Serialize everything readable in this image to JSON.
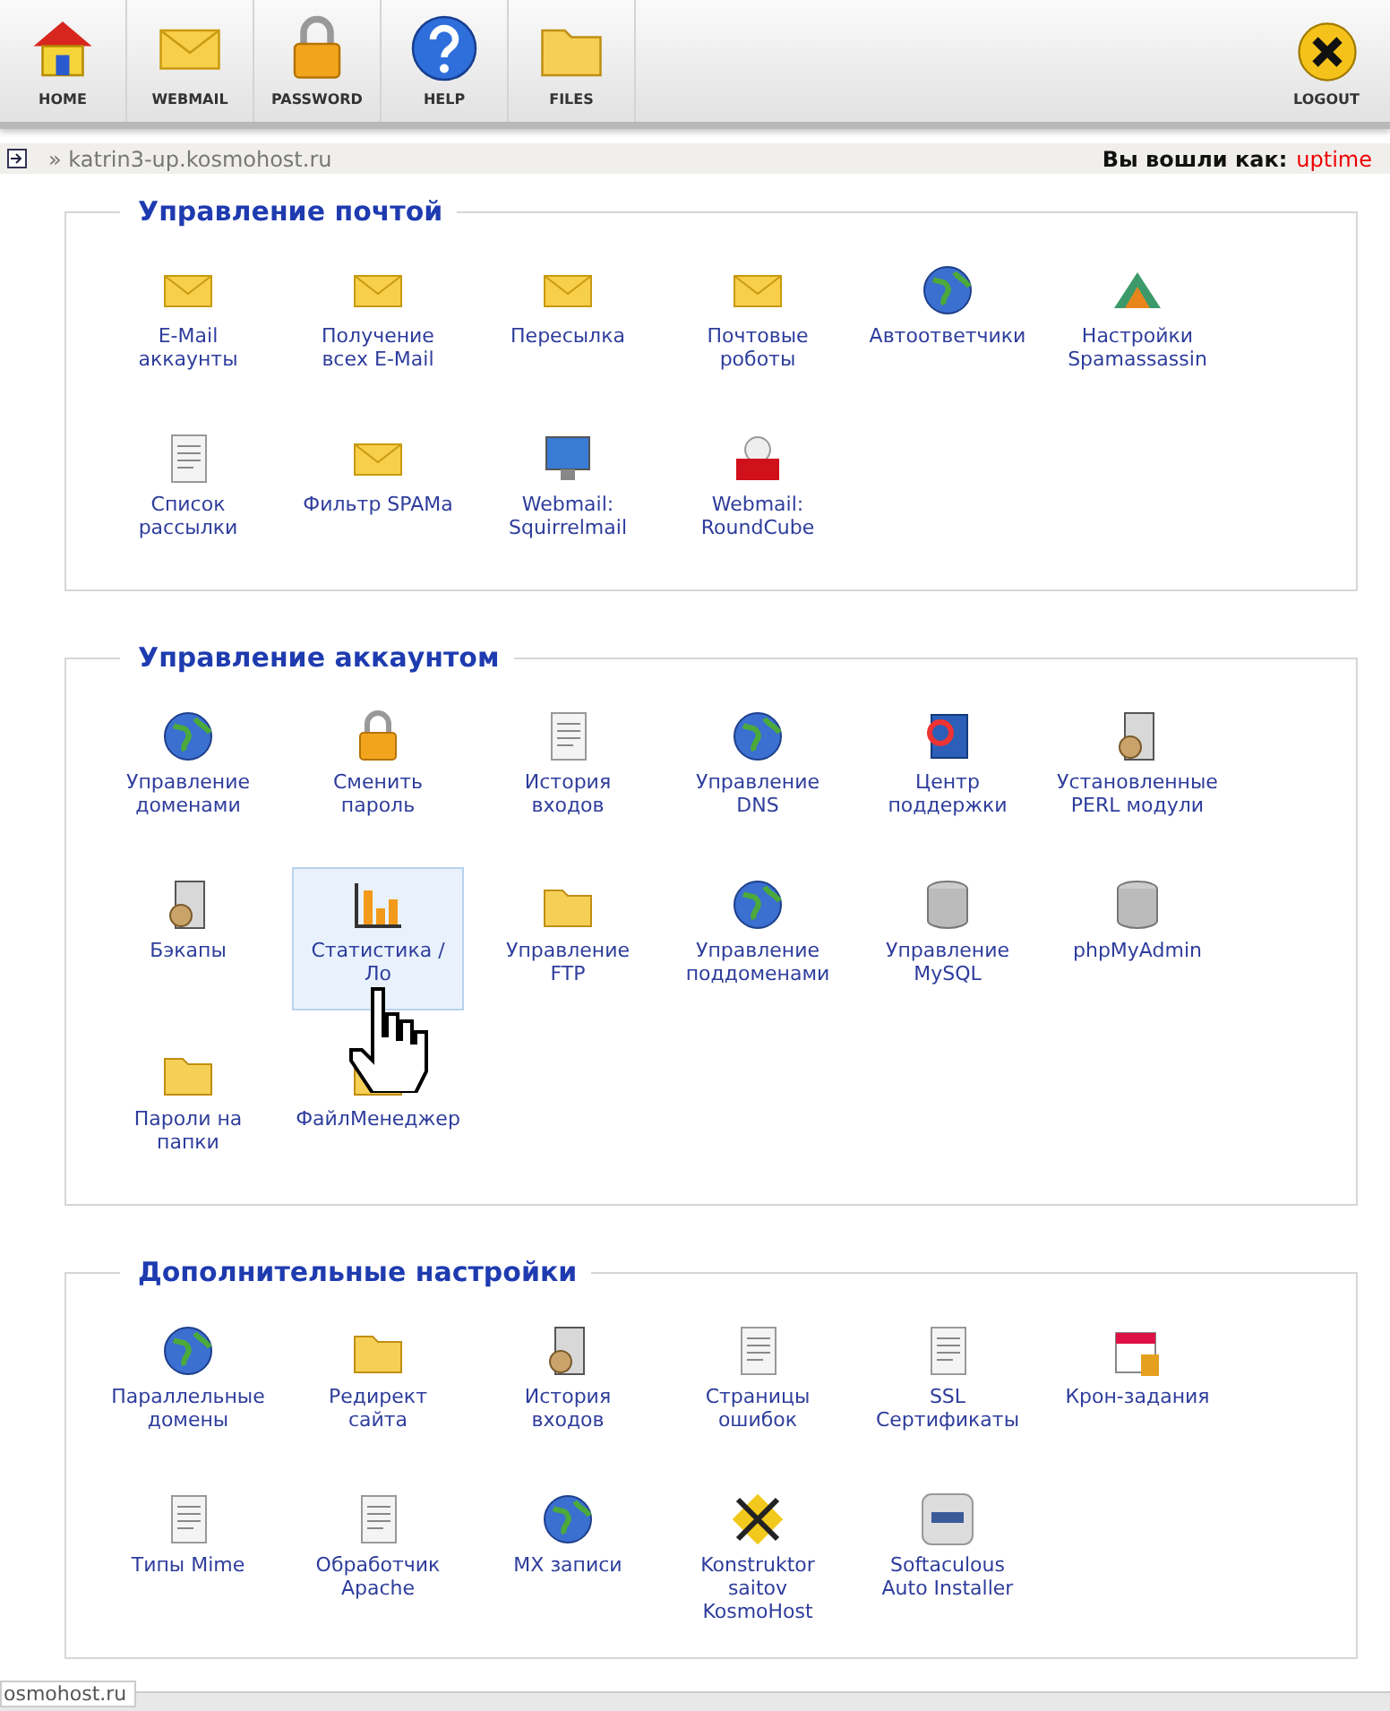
{
  "toolbar": {
    "buttons": [
      {
        "label": "HOME"
      },
      {
        "label": "WEBMAIL"
      },
      {
        "label": "PASSWORD"
      },
      {
        "label": "HELP"
      },
      {
        "label": "FILES"
      }
    ],
    "logout": {
      "label": "LOGOUT"
    }
  },
  "breadcrumb": {
    "path": "» katrin3-up.kosmohost.ru",
    "login_label": "Вы вошли как:",
    "user": "uptime"
  },
  "sections": [
    {
      "title": "Управление почтой",
      "items": [
        {
          "label": "E-Mail\nаккаунты",
          "selected": false
        },
        {
          "label": "Получение\nвсех E-Mail",
          "selected": false
        },
        {
          "label": "Пересылка",
          "selected": false
        },
        {
          "label": "Почтовые\nроботы",
          "selected": false
        },
        {
          "label": "Автоответчики",
          "selected": false
        },
        {
          "label": "Настройки\nSpamassassin",
          "selected": false
        },
        {
          "label": "Список\nрассылки",
          "selected": false
        },
        {
          "label": "Фильтр SPAMa",
          "selected": false
        },
        {
          "label": "Webmail:\nSquirrelmail",
          "selected": false
        },
        {
          "label": "Webmail:\nRoundCube",
          "selected": false
        }
      ]
    },
    {
      "title": "Управление аккаунтом",
      "items": [
        {
          "label": "Управление\nдоменами",
          "selected": false
        },
        {
          "label": "Сменить\nпароль",
          "selected": false
        },
        {
          "label": "История\nвходов",
          "selected": false
        },
        {
          "label": "Управление\nDNS",
          "selected": false
        },
        {
          "label": "Центр\nподдержки",
          "selected": false
        },
        {
          "label": "Установленные\nPERL модули",
          "selected": false
        },
        {
          "label": "Бэкапы",
          "selected": false
        },
        {
          "label": "Статистика /\nЛо",
          "selected": true
        },
        {
          "label": "Управление\nFTP",
          "selected": false
        },
        {
          "label": "Управление\nподдоменами",
          "selected": false
        },
        {
          "label": "Управление\nMySQL",
          "selected": false
        },
        {
          "label": "phpMyAdmin",
          "selected": false
        },
        {
          "label": "Пароли на\nпапки",
          "selected": false
        },
        {
          "label": "ФайлМенеджер",
          "selected": false
        }
      ]
    },
    {
      "title": "Дополнительные настройки",
      "items": [
        {
          "label": "Параллельные\nдомены",
          "selected": false
        },
        {
          "label": "Редирект\nсайта",
          "selected": false
        },
        {
          "label": "История\nвходов",
          "selected": false
        },
        {
          "label": "Страницы\nошибок",
          "selected": false
        },
        {
          "label": "SSL\nСертификаты",
          "selected": false
        },
        {
          "label": "Крон-задания",
          "selected": false
        },
        {
          "label": "Типы Mime",
          "selected": false
        },
        {
          "label": "Обработчик\nApache",
          "selected": false
        },
        {
          "label": "MX записи",
          "selected": false
        },
        {
          "label": "Konstruktor\nsaitov\nKosmoHost",
          "selected": false
        },
        {
          "label": "Softaculous\nAuto Installer",
          "selected": false
        }
      ]
    }
  ],
  "status_bar": {
    "url": "osmohost.ru"
  }
}
